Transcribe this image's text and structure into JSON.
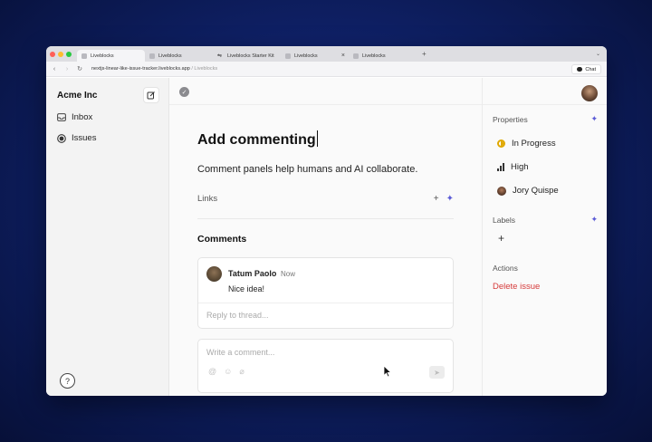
{
  "browser": {
    "tabs": [
      {
        "label": "Liveblocks",
        "active": true
      },
      {
        "label": "Liveblocks",
        "active": false
      },
      {
        "label": "Liveblocks Starter Kit",
        "active": false
      },
      {
        "label": "Liveblocks",
        "active": false,
        "closable": true
      },
      {
        "label": "Liveblocks",
        "active": false
      }
    ],
    "new_tab": "+",
    "url": "nextjs-linear-like-issue-tracker.liveblocks.app",
    "url_suffix": " / Liveblocks",
    "chat_label": "Chat"
  },
  "sidebar": {
    "org_name": "Acme Inc",
    "items": [
      {
        "label": "Inbox",
        "icon": "inbox-icon"
      },
      {
        "label": "Issues",
        "icon": "issues-icon"
      }
    ],
    "help": "?"
  },
  "issue": {
    "title": "Add commenting",
    "description": "Comment panels help humans and AI collaborate.",
    "links_label": "Links",
    "comments_heading": "Comments",
    "thread": {
      "author": "Tatum Paolo",
      "time": "Now",
      "body": "Nice idea!",
      "reply_placeholder": "Reply to thread..."
    },
    "composer_placeholder": "Write a comment..."
  },
  "properties": {
    "heading": "Properties",
    "status": "In Progress",
    "priority": "High",
    "assignee": "Jory Quispe",
    "labels_heading": "Labels",
    "actions_heading": "Actions",
    "delete_label": "Delete issue"
  },
  "colors": {
    "accent": "#5b5bd6",
    "danger": "#d63b3b",
    "in_progress": "#e0a800"
  }
}
